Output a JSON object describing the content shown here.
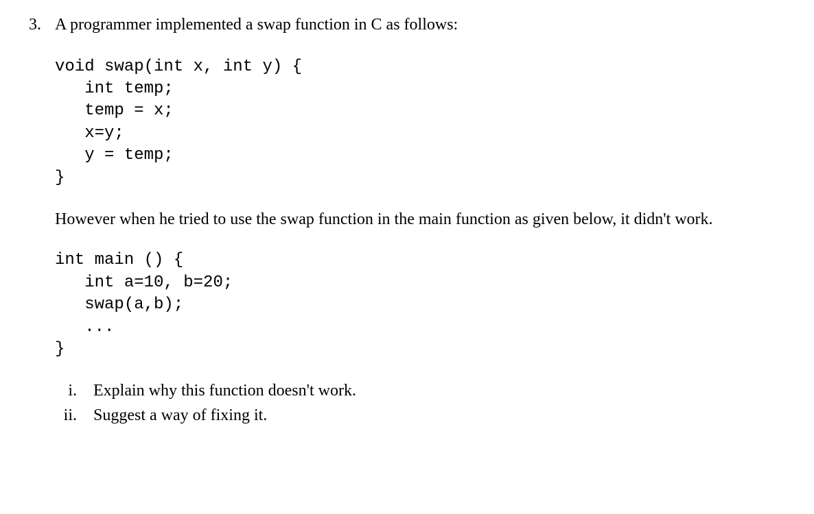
{
  "question": {
    "number": "3.",
    "intro": "A programmer implemented a swap function in C as follows:",
    "code1": "void swap(int x, int y) {\n   int temp;\n   temp = x;\n   x=y;\n   y = temp;\n}",
    "middle": "However when he tried to use the swap function in the main function as given below, it didn't work.",
    "code2": "int main () {\n   int a=10, b=20;\n   swap(a,b);\n   ...\n}",
    "subs": [
      {
        "label": "i.",
        "text": "Explain why this function doesn't work."
      },
      {
        "label": "ii.",
        "text": "Suggest a way of fixing it."
      }
    ]
  }
}
